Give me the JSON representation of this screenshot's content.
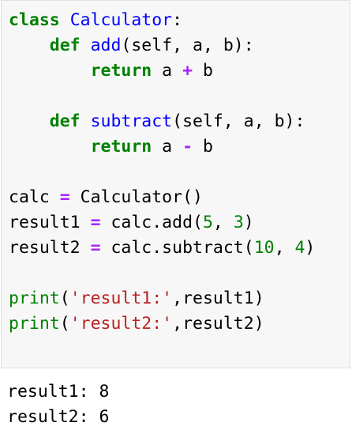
{
  "code": {
    "lines": [
      [
        "class",
        " ",
        "Calculator",
        ":"
      ],
      [
        "    ",
        "def",
        " ",
        "add",
        "(self, a, b):"
      ],
      [
        "        ",
        "return",
        " a ",
        "+",
        " b"
      ],
      [
        ""
      ],
      [
        "    ",
        "def",
        " ",
        "subtract",
        "(self, a, b):"
      ],
      [
        "        ",
        "return",
        " a ",
        "-",
        " b"
      ],
      [
        ""
      ],
      [
        "calc ",
        "=",
        " Calculator()"
      ],
      [
        "result1 ",
        "=",
        " calc.add(",
        "5",
        ", ",
        "3",
        ")"
      ],
      [
        "result2 ",
        "=",
        " calc.subtract(",
        "10",
        ", ",
        "4",
        ")"
      ],
      [
        ""
      ],
      [
        "print",
        "(",
        "'result1:'",
        ",result1)"
      ],
      [
        "print",
        "(",
        "'result2:'",
        ",result2)"
      ]
    ]
  },
  "output": {
    "lines": [
      "result1: 8",
      "result2: 6"
    ]
  },
  "colors": {
    "keyword": "#008000",
    "name": "#0000ff",
    "operator": "#aa22ff",
    "number": "#008000",
    "string": "#ba2121",
    "cell_background": "#f7f7f7"
  }
}
